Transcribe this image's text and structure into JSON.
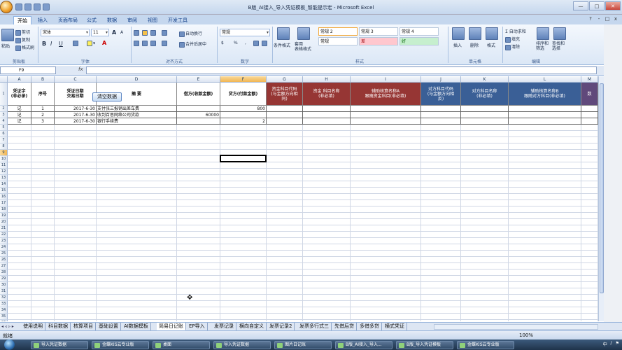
{
  "window": {
    "title": "B版_AI接入_导入凭证模板_智能提示宏 - Microsoft Excel",
    "controls": [
      "—",
      "□",
      "✕"
    ],
    "doc_controls": [
      "?",
      "-",
      "□",
      "x"
    ]
  },
  "ribbon": {
    "tabs": [
      "开始",
      "插入",
      "页面布局",
      "公式",
      "数据",
      "审阅",
      "视图",
      "开发工具"
    ],
    "clipboard": {
      "paste": "粘贴",
      "cut": "剪切",
      "copy": "复制",
      "format_painter": "格式刷",
      "label": "剪贴板"
    },
    "font": {
      "name": "宋体",
      "size": "11",
      "label": "字体",
      "bold": "B",
      "italic": "I",
      "underline": "U",
      "grow": "A",
      "shrink": "A",
      "color": "A",
      "fill_color": "▾"
    },
    "alignment": {
      "wrap": "自动换行",
      "merge": "合并后居中",
      "label": "对齐方式"
    },
    "number": {
      "format": "常规",
      "currency": "$",
      "percent": "%",
      "comma": ",",
      "label": "数字"
    },
    "styles": {
      "conditional": "条件格式",
      "table": "套用\n表格格式",
      "cells": [
        "常规 2",
        "常规 3",
        "常规 4",
        "常规",
        "差",
        "好"
      ],
      "label": "样式"
    },
    "cells": {
      "insert": "插入",
      "delete": "删除",
      "format": "格式",
      "label": "单元格"
    },
    "editing": {
      "autosum": "Σ 自动求和",
      "fill": "填充",
      "clear": "清除",
      "sort": "排序和\n筛选",
      "find": "查找和\n选择",
      "label": "编辑"
    }
  },
  "formula_bar": {
    "name_box": "F9",
    "fx": "fx",
    "value": ""
  },
  "grid": {
    "columns": [
      {
        "letter": "A",
        "w": 34
      },
      {
        "letter": "B",
        "w": 33
      },
      {
        "letter": "C",
        "w": 60
      },
      {
        "letter": "D",
        "w": 115
      },
      {
        "letter": "E",
        "w": 62
      },
      {
        "letter": "F",
        "w": 66
      },
      {
        "letter": "G",
        "w": 52
      },
      {
        "letter": "H",
        "w": 68
      },
      {
        "letter": "I",
        "w": 101
      },
      {
        "letter": "J",
        "w": 57
      },
      {
        "letter": "K",
        "w": 68
      },
      {
        "letter": "L",
        "w": 104
      },
      {
        "letter": "M",
        "w": 24
      }
    ],
    "selected_col": "F",
    "selected_row": 9,
    "row_count": 36,
    "headers": [
      {
        "text": "凭证字\n(非必录)",
        "style": ""
      },
      {
        "text": "序号",
        "style": ""
      },
      {
        "text": "凭证日期\n交易日期",
        "style": ""
      },
      {
        "text": "摘    要",
        "style": ""
      },
      {
        "text": "借方(收款金额)",
        "style": ""
      },
      {
        "text": "贷方(付款金额)",
        "style": ""
      },
      {
        "text": "资金科目代码\n(与金额方向相\n同)",
        "style": "red"
      },
      {
        "text": "资金 科目名称\n(非必填)",
        "style": "red"
      },
      {
        "text": "辅助核算名称A\n跟随资金科目(非必填)",
        "style": "red"
      },
      {
        "text": "对方科目代码\n(与金额方向相\n反)",
        "style": "blue"
      },
      {
        "text": "对方科目名称\n(非必填)",
        "style": "blue"
      },
      {
        "text": "辅助核算名称B\n跟随对方科目(非必填)",
        "style": "blue"
      },
      {
        "text": "数",
        "style": "purple"
      }
    ],
    "rows": [
      [
        "记",
        "1",
        "2017-6-30",
        "支付张三报销出差车费",
        "",
        "800",
        "",
        "",
        "",
        "",
        "",
        "",
        ""
      ],
      [
        "记",
        "2",
        "2017-6-30",
        "收到百思网络公司货款",
        "60000",
        "",
        "",
        "",
        "",
        "",
        "",
        "",
        ""
      ],
      [
        "记",
        "3",
        "2017-6-30",
        "银行手续费",
        "",
        "2",
        "",
        "",
        "",
        "",
        "",
        "",
        ""
      ]
    ],
    "clear_button": "清空数据"
  },
  "sheet_tabs": {
    "nav": "◂ ◃ ▹ ▸",
    "tabs": [
      "使用说明",
      "科目数据",
      "核算项目",
      "基础设置",
      "AI数据模板",
      "简易日记账",
      "EP导入",
      "发票记录",
      "横向自定义",
      "发票记录2",
      "发票多行式三",
      "先借后贷",
      "多借多贷",
      "横式凭证"
    ],
    "active": "简易日记账"
  },
  "status_bar": {
    "text": "就绪",
    "zoom": "100%"
  },
  "taskbar": {
    "items": [
      "导入凭证数据",
      "金蝶KIS云专业版",
      "桌面",
      "导入凭证数据",
      "图片日记账",
      "B版_AI接入_导入...",
      "B版_导入凭证模板",
      "金蝶KIS云专业版"
    ],
    "tray": [
      "中",
      "♪",
      "⚑"
    ]
  }
}
